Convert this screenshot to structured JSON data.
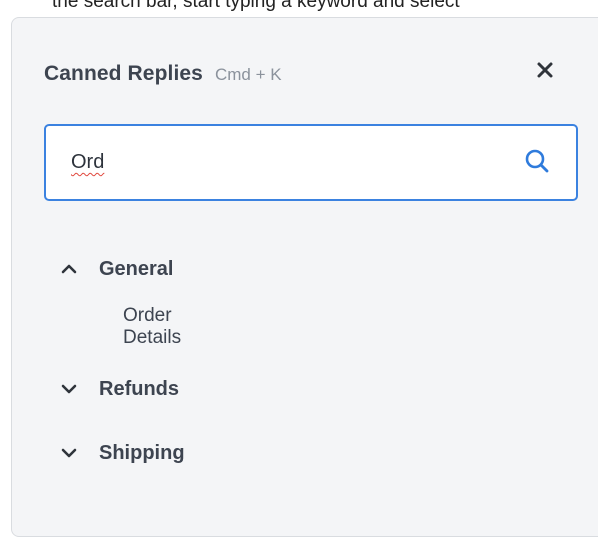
{
  "background_caption": "the search bar, start typing a keyword and select",
  "panel": {
    "title": "Canned Replies",
    "shortcut": "Cmd + K",
    "close_icon": "close-icon"
  },
  "search": {
    "value": "Ord",
    "icon": "search-icon",
    "border_color": "#3b82e0"
  },
  "tree": {
    "groups": [
      {
        "label": "General",
        "expanded": true,
        "items": [
          "Order Details"
        ]
      },
      {
        "label": "Refunds",
        "expanded": false,
        "items": []
      },
      {
        "label": "Shipping",
        "expanded": false,
        "items": []
      }
    ]
  }
}
